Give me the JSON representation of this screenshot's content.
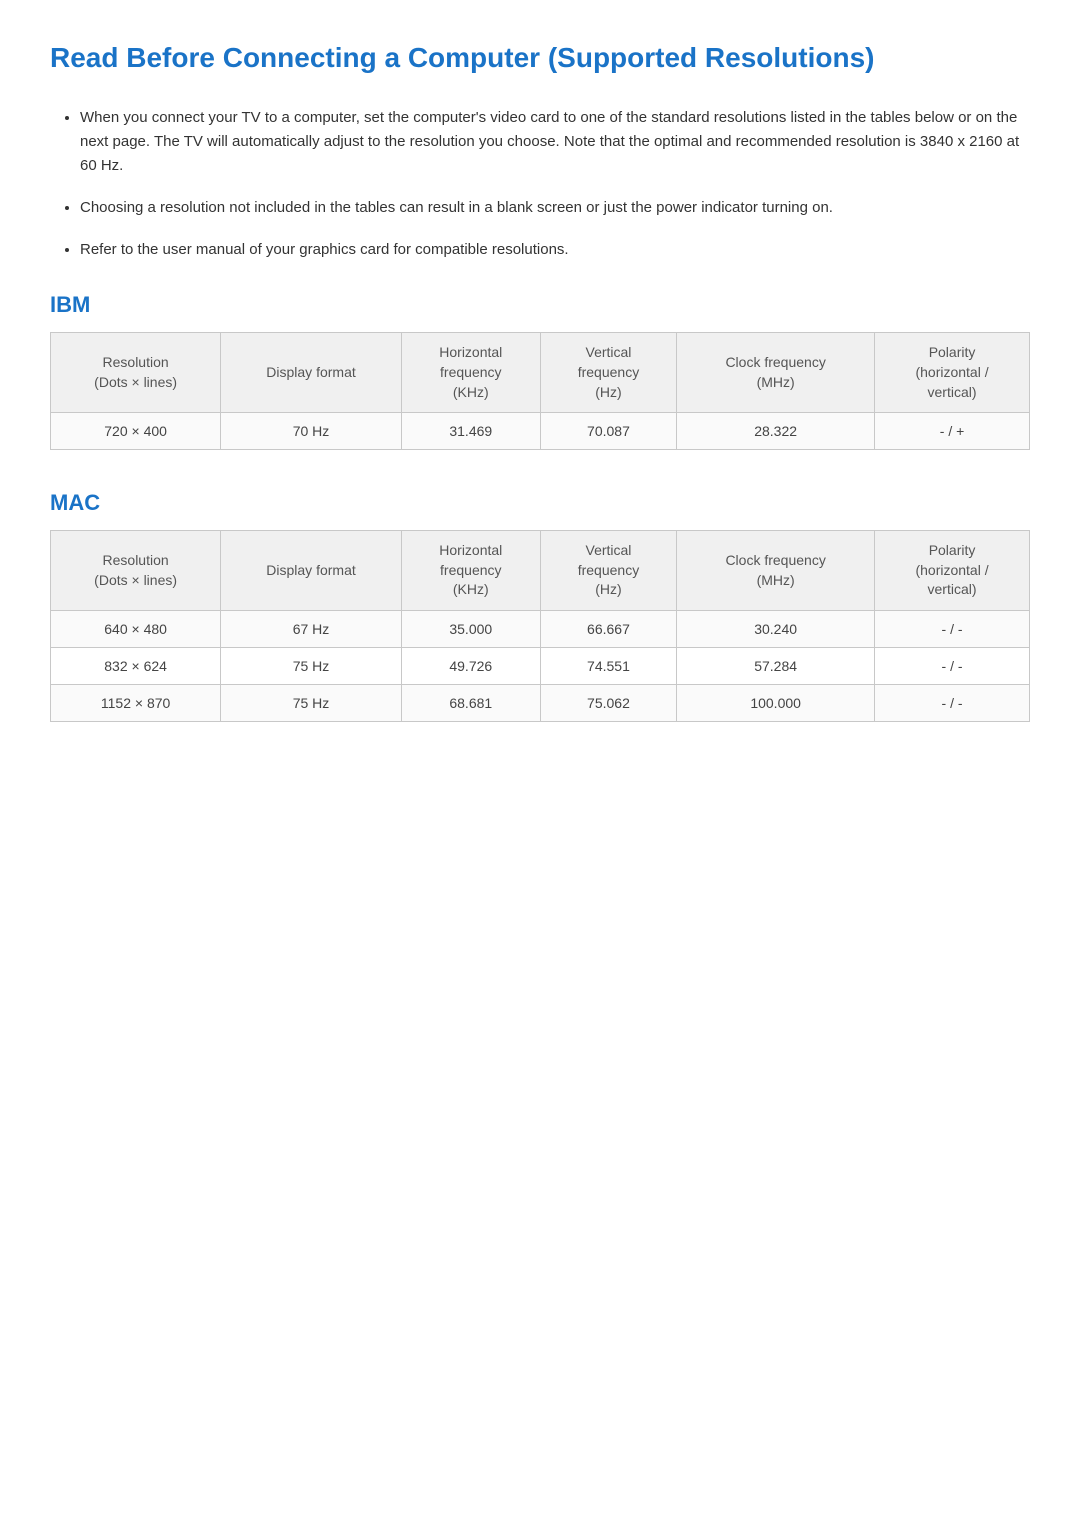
{
  "page": {
    "title": "Read Before Connecting a Computer (Supported Resolutions)",
    "bullets": [
      "When you connect your TV to a computer, set the computer's video card to one of the standard resolutions listed in the tables below or on the next page. The TV will automatically adjust to the resolution you choose. Note that the optimal and recommended resolution is 3840 x 2160 at 60 Hz.",
      "Choosing a resolution not included in the tables can result in a blank screen or just the power indicator turning on.",
      "Refer to the user manual of your graphics card for compatible resolutions."
    ]
  },
  "ibm": {
    "heading": "IBM",
    "columns": {
      "resolution": "Resolution\n(Dots x lines)",
      "display_format": "Display format",
      "h_freq": "Horizontal\nfrequency\n(KHz)",
      "v_freq": "Vertical\nfrequency\n(Hz)",
      "clock": "Clock frequency\n(MHz)",
      "polarity": "Polarity\n(horizontal /\nvertical)"
    },
    "rows": [
      {
        "resolution": "720 × 400",
        "display_format": "70 Hz",
        "h_freq": "31.469",
        "v_freq": "70.087",
        "clock": "28.322",
        "polarity": "- / +"
      }
    ]
  },
  "mac": {
    "heading": "MAC",
    "columns": {
      "resolution": "Resolution\n(Dots x lines)",
      "display_format": "Display format",
      "h_freq": "Horizontal\nfrequency\n(KHz)",
      "v_freq": "Vertical\nfrequency\n(Hz)",
      "clock": "Clock frequency\n(MHz)",
      "polarity": "Polarity\n(horizontal /\nvertical)"
    },
    "rows": [
      {
        "resolution": "640 × 480",
        "display_format": "67 Hz",
        "h_freq": "35.000",
        "v_freq": "66.667",
        "clock": "30.240",
        "polarity": "- / -"
      },
      {
        "resolution": "832 × 624",
        "display_format": "75 Hz",
        "h_freq": "49.726",
        "v_freq": "74.551",
        "clock": "57.284",
        "polarity": "- / -"
      },
      {
        "resolution": "1152 × 870",
        "display_format": "75 Hz",
        "h_freq": "68.681",
        "v_freq": "75.062",
        "clock": "100.000",
        "polarity": "- / -"
      }
    ]
  }
}
